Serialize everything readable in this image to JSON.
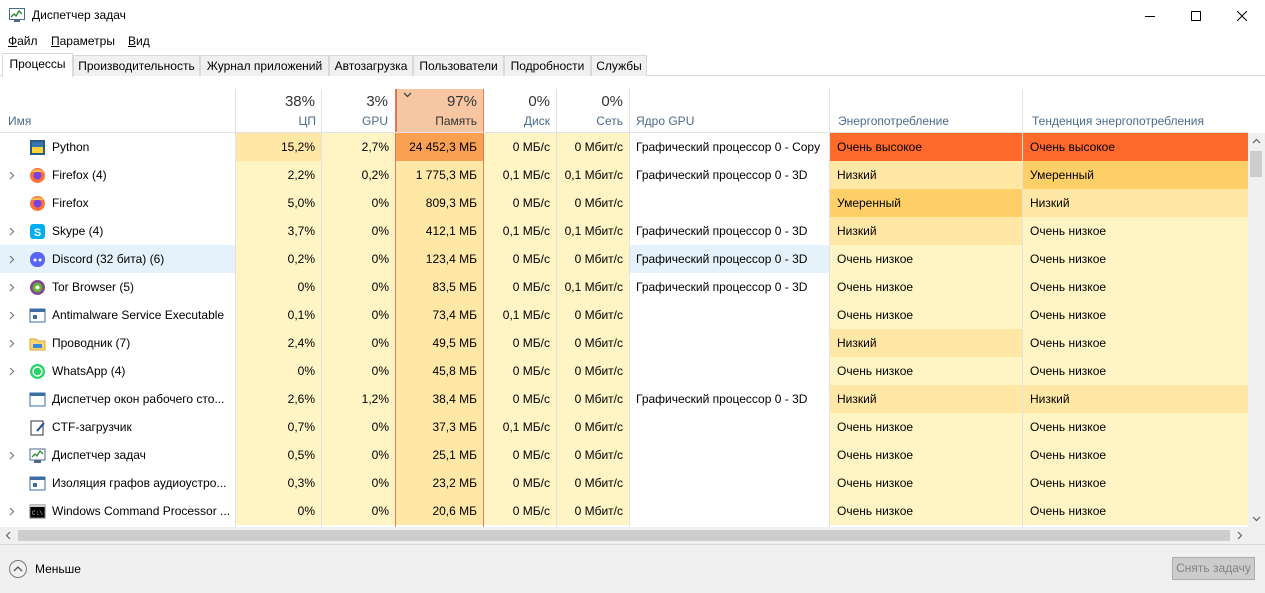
{
  "window": {
    "title": "Диспетчер задач",
    "icon": "task-manager-icon"
  },
  "menu": [
    "Файл",
    "Параметры",
    "Вид"
  ],
  "tabs": [
    {
      "label": "Процессы",
      "active": true
    },
    {
      "label": "Производительность",
      "active": false
    },
    {
      "label": "Журнал приложений",
      "active": false
    },
    {
      "label": "Автозагрузка",
      "active": false
    },
    {
      "label": "Пользователи",
      "active": false
    },
    {
      "label": "Подробности",
      "active": false
    },
    {
      "label": "Службы",
      "active": false
    }
  ],
  "columns": {
    "name": "Имя",
    "cpu": {
      "pct": "38%",
      "label": "ЦП"
    },
    "gpu": {
      "pct": "3%",
      "label": "GPU"
    },
    "memory": {
      "pct": "97%",
      "label": "Память",
      "sorted": true
    },
    "disk": {
      "pct": "0%",
      "label": "Диск"
    },
    "network": {
      "pct": "0%",
      "label": "Сеть"
    },
    "gpu_engine": "Ядро GPU",
    "power": "Энергопотребление",
    "power_trend": "Тенденция энергопотребления"
  },
  "colors": {
    "heat_low": "#fff4c4",
    "heat_mid": "#ffe7a6",
    "heat_high": "#f9a051",
    "very_high": "#fd6a2c",
    "moderate": "#ffd067",
    "sort_header": "#f6c7a2",
    "sort_border": "#e06d4c"
  },
  "processes": [
    {
      "name": "Python",
      "icon": "python-icon",
      "expandable": false,
      "cpu": "15,2%",
      "gpu": "2,7%",
      "memory": "24 452,3 МБ",
      "disk": "0 МБ/с",
      "network": "0 Мбит/с",
      "gpu_engine": "Графический процессор 0 - Copy",
      "power": "Очень высокое",
      "trend": "Очень высокое"
    },
    {
      "name": "Firefox (4)",
      "icon": "firefox-icon",
      "expandable": true,
      "cpu": "2,2%",
      "gpu": "0,2%",
      "memory": "1 775,3 МБ",
      "disk": "0,1 МБ/с",
      "network": "0,1 Мбит/с",
      "gpu_engine": "Графический процессор 0 - 3D",
      "power": "Низкий",
      "trend": "Умеренный"
    },
    {
      "name": "Firefox",
      "icon": "firefox-icon",
      "expandable": false,
      "cpu": "5,0%",
      "gpu": "0%",
      "memory": "809,3 МБ",
      "disk": "0 МБ/с",
      "network": "0 Мбит/с",
      "gpu_engine": "",
      "power": "Умеренный",
      "trend": "Низкий"
    },
    {
      "name": "Skype (4)",
      "icon": "skype-icon",
      "expandable": true,
      "cpu": "3,7%",
      "gpu": "0%",
      "memory": "412,1 МБ",
      "disk": "0,1 МБ/с",
      "network": "0,1 Мбит/с",
      "gpu_engine": "Графический процессор 0 - 3D",
      "power": "Низкий",
      "trend": "Очень низкое"
    },
    {
      "name": "Discord (32 бита) (6)",
      "icon": "discord-icon",
      "expandable": true,
      "cpu": "0,2%",
      "gpu": "0%",
      "memory": "123,4 МБ",
      "disk": "0 МБ/с",
      "network": "0 Мбит/с",
      "gpu_engine": "Графический процессор 0 - 3D",
      "power": "Очень низкое",
      "trend": "Очень низкое"
    },
    {
      "name": "Tor Browser (5)",
      "icon": "tor-browser-icon",
      "expandable": true,
      "cpu": "0%",
      "gpu": "0%",
      "memory": "83,5 МБ",
      "disk": "0 МБ/с",
      "network": "0,1 Мбит/с",
      "gpu_engine": "Графический процессор 0 - 3D",
      "power": "Очень низкое",
      "trend": "Очень низкое"
    },
    {
      "name": "Antimalware Service Executable",
      "icon": "service-icon",
      "expandable": true,
      "cpu": "0,1%",
      "gpu": "0%",
      "memory": "73,4 МБ",
      "disk": "0,1 МБ/с",
      "network": "0 Мбит/с",
      "gpu_engine": "",
      "power": "Очень низкое",
      "trend": "Очень низкое"
    },
    {
      "name": "Проводник (7)",
      "icon": "folder-icon",
      "expandable": true,
      "cpu": "2,4%",
      "gpu": "0%",
      "memory": "49,5 МБ",
      "disk": "0 МБ/с",
      "network": "0 Мбит/с",
      "gpu_engine": "",
      "power": "Низкий",
      "trend": "Очень низкое"
    },
    {
      "name": "WhatsApp (4)",
      "icon": "whatsapp-icon",
      "expandable": true,
      "cpu": "0%",
      "gpu": "0%",
      "memory": "45,8 МБ",
      "disk": "0 МБ/с",
      "network": "0 Мбит/с",
      "gpu_engine": "",
      "power": "Очень низкое",
      "trend": "Очень низкое"
    },
    {
      "name": "Диспетчер окон рабочего сто...",
      "icon": "window-manager-icon",
      "expandable": false,
      "cpu": "2,6%",
      "gpu": "1,2%",
      "memory": "38,4 МБ",
      "disk": "0 МБ/с",
      "network": "0 Мбит/с",
      "gpu_engine": "Графический процессор 0 - 3D",
      "power": "Низкий",
      "trend": "Низкий"
    },
    {
      "name": "CTF-загрузчик",
      "icon": "ctf-loader-icon",
      "expandable": false,
      "cpu": "0,7%",
      "gpu": "0%",
      "memory": "37,3 МБ",
      "disk": "0,1 МБ/с",
      "network": "0 Мбит/с",
      "gpu_engine": "",
      "power": "Очень низкое",
      "trend": "Очень низкое"
    },
    {
      "name": "Диспетчер задач",
      "icon": "task-manager-icon",
      "expandable": true,
      "cpu": "0,5%",
      "gpu": "0%",
      "memory": "25,1 МБ",
      "disk": "0 МБ/с",
      "network": "0 Мбит/с",
      "gpu_engine": "",
      "power": "Очень низкое",
      "trend": "Очень низкое"
    },
    {
      "name": "Изоляция графов аудиоустро...",
      "icon": "service-icon",
      "expandable": false,
      "cpu": "0,3%",
      "gpu": "0%",
      "memory": "23,2 МБ",
      "disk": "0 МБ/с",
      "network": "0 Мбит/с",
      "gpu_engine": "",
      "power": "Очень низкое",
      "trend": "Очень низкое"
    },
    {
      "name": "Windows Command Processor ...",
      "icon": "cmd-icon",
      "expandable": true,
      "cpu": "0%",
      "gpu": "0%",
      "memory": "20,6 МБ",
      "disk": "0 МБ/с",
      "network": "0 Мбит/с",
      "gpu_engine": "",
      "power": "Очень низкое",
      "trend": "Очень низкое"
    }
  ],
  "footer": {
    "less_label": "Меньше",
    "end_task_label": "Снять задачу"
  }
}
